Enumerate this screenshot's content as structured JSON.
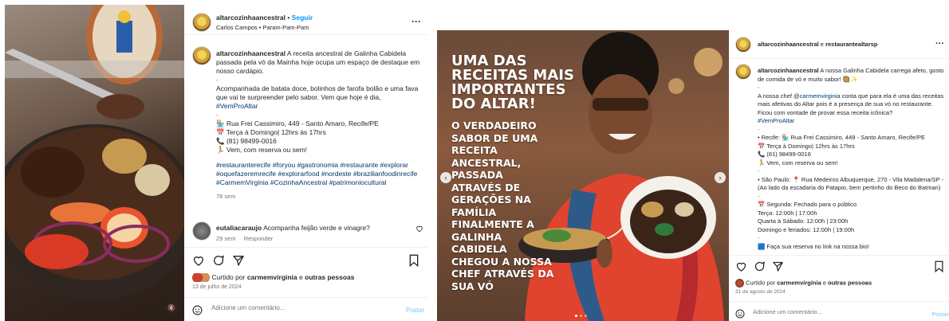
{
  "post1": {
    "header": {
      "username": "altarcozinhaancestral",
      "separator": "•",
      "follow": "Seguir",
      "subtitle": "Carlos Campos • Param-Pam-Pam",
      "more": "···"
    },
    "caption": {
      "username": "altarcozinhaancestral",
      "text1": "A receita ancestral de Galinha Cabidela passada pela vó da Mainha hoje ocupa um espaço de destaque em nosso cardápio.",
      "dash1": "-",
      "text2": "Acompanhada de batata doce, bolinhos de farofa bolão e uma fava que vai te surpreender pelo sabor. Vem que hoje é dia,",
      "tag1": "#VemProAltar",
      "dash2": "-",
      "info": [
        "🏪 Rua Frei Cassimiro, 449 - Santo Amaro, Recife/PE",
        "📅 Terça à Domingo| 12hrs às 17hrs",
        "📞 (81) 98499-0016",
        "🏃 Vem, com reserva ou sem!"
      ],
      "hashtags": "#restauranterecife #foryou #gastronomia #restaurante #explorar #oquefazeremrecife #explorarfood #nordeste #brazilianfoodinrecife #CarmemVirginia #CozinhaAncestral #patrimoniocultural",
      "time": "78 sem"
    },
    "comment": {
      "username": "eutaliacaraujo",
      "text": "Acompanha feijão verde e vinagre?",
      "time": "29 sem",
      "reply": "Responder"
    },
    "likes": {
      "prefix": "Curtido por",
      "user": "carmemvirginia",
      "middle": "e",
      "others": "outras pessoas"
    },
    "date": "13 de julho de 2024",
    "add_comment": {
      "placeholder": "Adicione um comentário...",
      "post": "Postar"
    }
  },
  "post2": {
    "header": {
      "user1": "altarcozinhaancestral",
      "conj": "e",
      "user2": "restaurantealtarsp",
      "more": "···"
    },
    "image": {
      "lines": [
        "UMA DAS",
        "RECEITAS MAIS",
        "IMPORTANTES",
        "DO ALTAR!"
      ],
      "sublines": [
        "O VERDADEIRO",
        "SABOR DE UMA",
        "RECEITA",
        "ANCESTRAL,",
        "PASSADA",
        "ATRAVÉS DE",
        "GERAÇÕES NA",
        "FAMÍLIA",
        "FINALMENTE A",
        "GALINHA",
        "CABIDELA",
        "CHEGOU A NOSSA",
        "CHEF ATRAVÉS DA",
        "SUA VÓ"
      ]
    },
    "caption": {
      "username": "altarcozinhaancestral",
      "text1": "A nossa Galinha Cabidela carrega afeto, gosto de comida de vó e muito sabor! 🥘✨",
      "dash1": "-",
      "text2a": "A nossa chef",
      "mention": "@carmemvirginia",
      "text2b": "conta que para ela é uma das receitas mais afetivas do Altar pois é a presença de sua vó no restaurante. Ficou com vontade de provar essa receita icônica?",
      "tag1": "#VemProAltar",
      "dash2": "-",
      "recife": [
        "• Recife: 🏪 Rua Frei Cassimiro, 449 - Santo Amaro, Recife/PE",
        "📅 Terça à Domingo| 12hrs às 17hrs",
        "📞 (81) 98499-0016",
        "🏃 Vem, com reserva ou sem!"
      ],
      "dash3": "-",
      "sp": "• São Paulo: 📍 Rua Medeiros Albuquerque, 270 - Vila Madalena/SP - (Ao lado da escadaria do Patapio, bem pertinho do Beco do Batman)",
      "dash4": "-",
      "hours": [
        "📅 Segunda: Fechado para o público",
        "Terça: 12:00h | 17:00h",
        "Quarta à Sábado: 12:00h | 23:00h",
        "Domingo e feriados: 12:00h | 19:00h"
      ],
      "dash5": "-",
      "reserve": "🟦 Faça sua reserva no link na nossa bio!"
    },
    "likes": {
      "prefix": "Curtido por",
      "user": "carmemvirginia",
      "middle": "e",
      "others": "outras pessoas"
    },
    "date": "31 de agosto de 2024",
    "add_comment": {
      "placeholder": "Adicione um comentário...",
      "post": "Postar"
    }
  },
  "colors": {
    "link_blue": "#0095f6",
    "hashtag": "#00376b",
    "muted": "#737373",
    "text": "#262626",
    "poster_red": "#c9422f"
  },
  "icons": [
    "heart-icon",
    "comment-icon",
    "share-icon",
    "bookmark-icon",
    "emoji-icon",
    "mute-icon",
    "chevron-left-icon",
    "chevron-right-icon",
    "more-icon"
  ]
}
